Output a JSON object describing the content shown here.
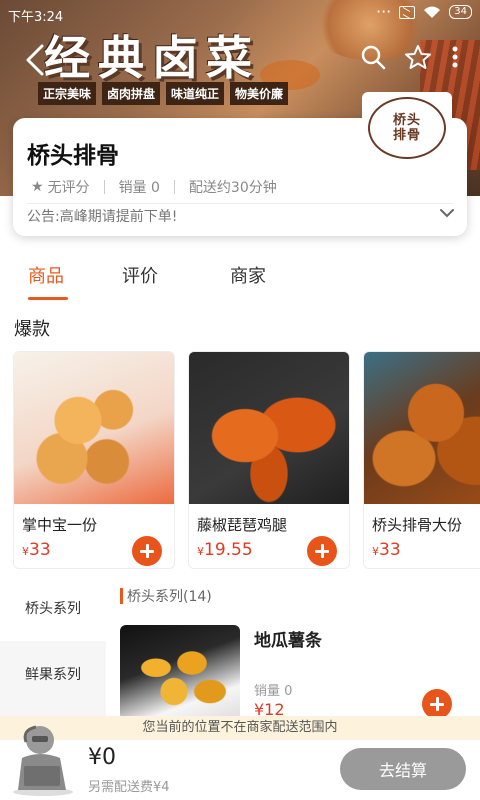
{
  "status_bar": {
    "time": "下午3:24",
    "battery": "34"
  },
  "hero": {
    "title": "经典卤菜",
    "tags": [
      "正宗美味",
      "卤肉拼盘",
      "味道纯正",
      "物美价廉"
    ]
  },
  "store": {
    "name": "桥头排骨",
    "rating": "无评分",
    "sales": "销量 0",
    "delivery_time": "配送约30分钟",
    "notice": "公告:高峰期请提前下单!",
    "logo_text": [
      "桥头",
      "排骨"
    ]
  },
  "tabs": [
    {
      "label": "商品",
      "active": true
    },
    {
      "label": "评价",
      "active": false
    },
    {
      "label": "商家",
      "active": false
    }
  ],
  "hot_section": {
    "title": "爆款",
    "items": [
      {
        "name": "掌中宝一份",
        "currency": "¥",
        "price": "33"
      },
      {
        "name": "藤椒琵琶鸡腿",
        "currency": "¥",
        "price": "19.55"
      },
      {
        "name": "桥头排骨大份",
        "currency": "¥",
        "price": "33"
      }
    ]
  },
  "categories": [
    {
      "label": "桥头系列",
      "active": true
    },
    {
      "label": "鲜果系列",
      "active": false
    }
  ],
  "current_category": "桥头系列(14)",
  "product": {
    "name": "地瓜薯条",
    "sales": "销量 0",
    "price": "¥12"
  },
  "range_notice": "您当前的位置不在商家配送范围内",
  "cart": {
    "total": "¥0",
    "delivery_fee": "另需配送费¥4",
    "checkout_label": "去结算"
  },
  "colors": {
    "accent": "#e85a1b",
    "price": "#e23a22",
    "checkout_disabled": "#9a9a9a",
    "notice_bg": "#fdf3dc"
  }
}
